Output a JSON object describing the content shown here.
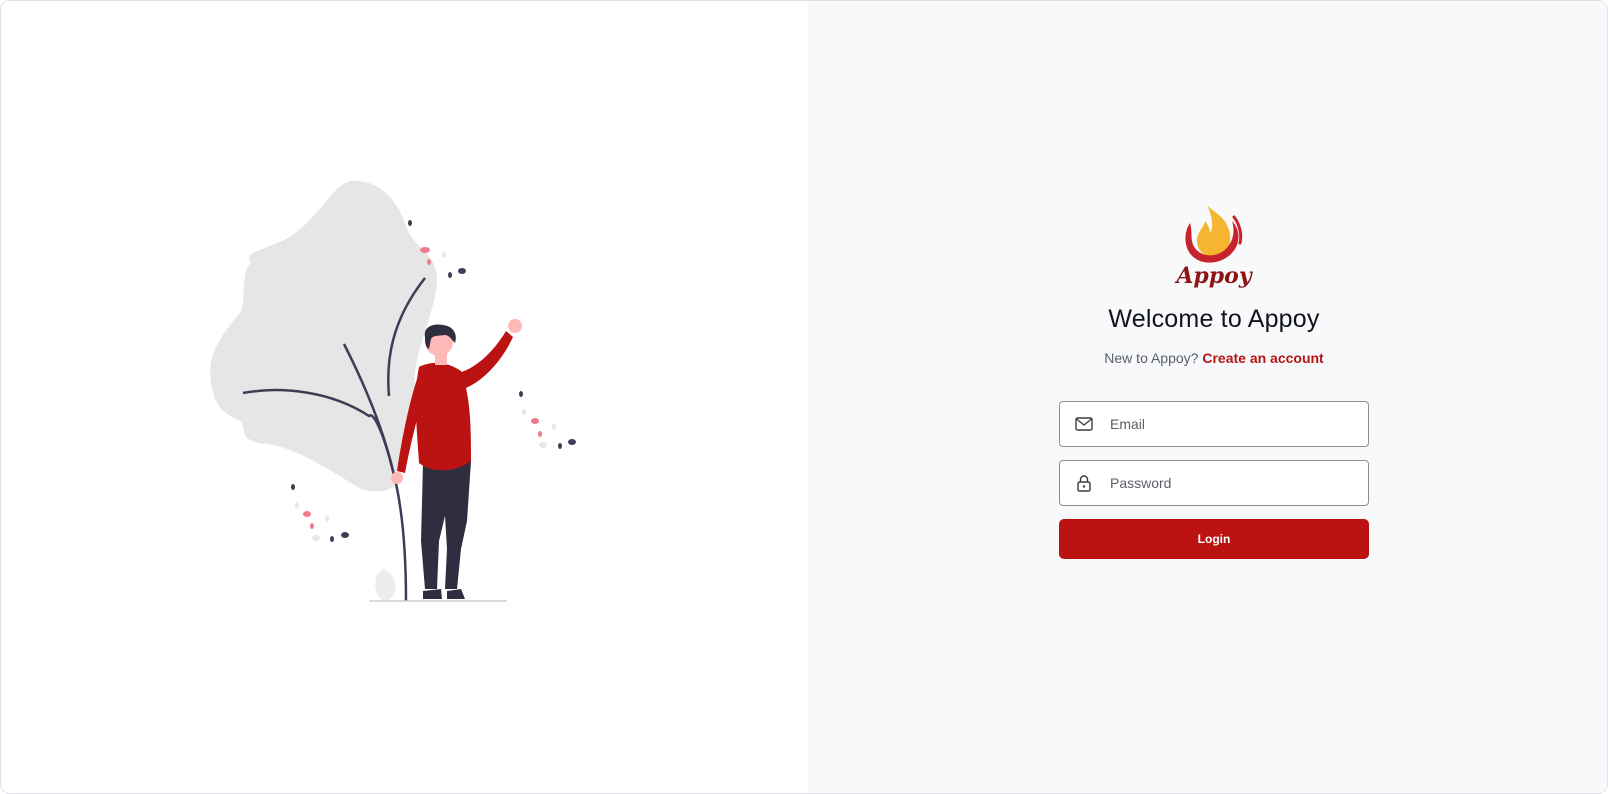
{
  "brand": {
    "logo_text": "Appoy",
    "colors": {
      "accent": "#bb1212",
      "flame_outer": "#c8232c",
      "flame_inner": "#f5b530",
      "right_bg": "#f8f9fb"
    }
  },
  "header": {
    "title": "Welcome to Appoy",
    "signup_prompt": "New to Appoy?",
    "signup_link": "Create an account"
  },
  "form": {
    "email": {
      "placeholder": "Email",
      "value": "",
      "icon": "mail-icon"
    },
    "password": {
      "placeholder": "Password",
      "value": "",
      "icon": "lock-icon"
    },
    "login_label": "Login"
  },
  "illustration": {
    "icon": "person-waving-illustration"
  }
}
